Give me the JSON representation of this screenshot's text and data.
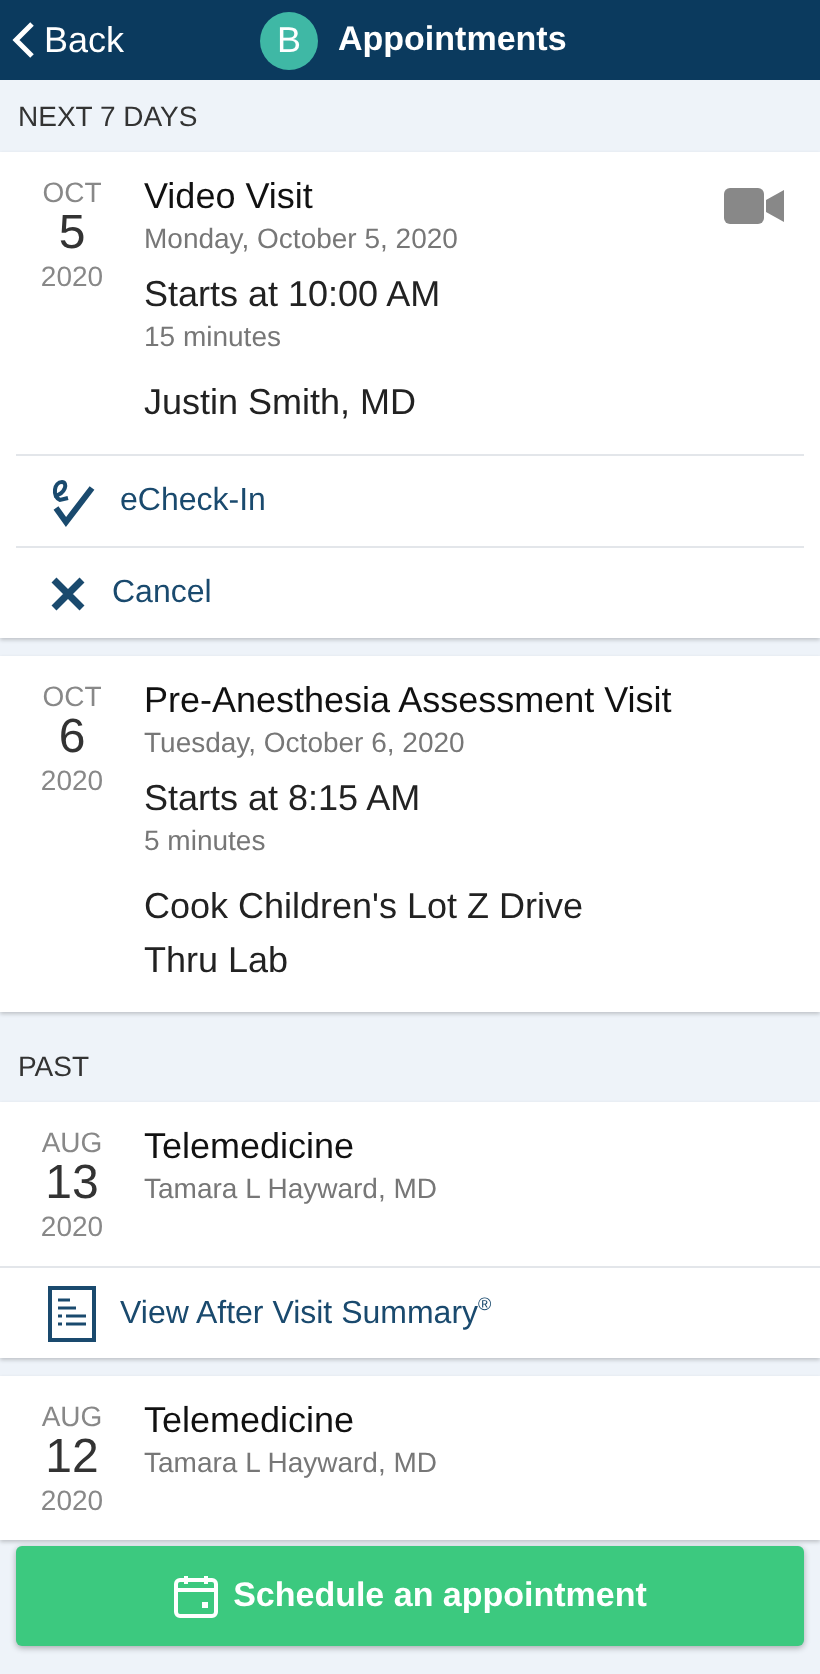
{
  "header": {
    "back": "Back",
    "avatar": "B",
    "title": "Appointments"
  },
  "sections": [
    {
      "title": "NEXT 7 DAYS",
      "cards": [
        {
          "month": "OCT",
          "day": "5",
          "year": "2020",
          "title": "Video Visit",
          "video": true,
          "date": "Monday, October 5, 2020",
          "start": "Starts at 10:00 AM",
          "duration": "15 minutes",
          "detail": "Justin Smith, MD",
          "actions": [
            {
              "kind": "echeckin",
              "label": "eCheck-In"
            },
            {
              "kind": "cancel",
              "label": "Cancel"
            }
          ]
        },
        {
          "month": "OCT",
          "day": "6",
          "year": "2020",
          "title": "Pre-Anesthesia Assessment Visit",
          "video": false,
          "date": "Tuesday, October 6, 2020",
          "start": "Starts at 8:15 AM",
          "duration": "5 minutes",
          "detail": "Cook Children's Lot Z Drive Thru Lab"
        }
      ]
    },
    {
      "title": "PAST",
      "cards": [
        {
          "month": "AUG",
          "day": "13",
          "year": "2020",
          "title": "Telemedicine",
          "video": false,
          "provider": "Tamara L Hayward, MD",
          "actions": [
            {
              "kind": "summary",
              "label": "View After Visit Summary$^{®}$"
            }
          ]
        },
        {
          "month": "AUG",
          "day": "12",
          "year": "2020",
          "title": "Telemedicine",
          "video": false,
          "provider": "Tamara L Hayward, MD"
        }
      ]
    }
  ],
  "schedule_button": "Schedule an appointment"
}
